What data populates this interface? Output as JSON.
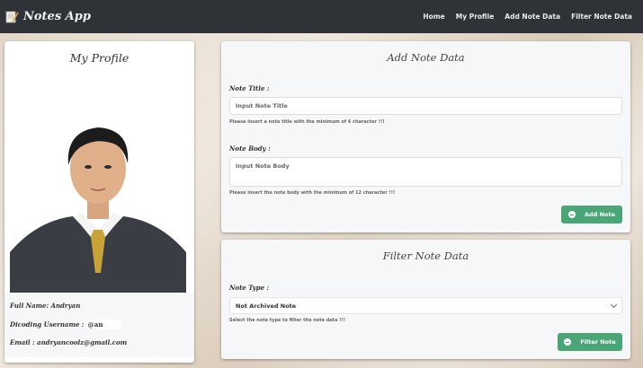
{
  "nav": {
    "brand": "Notes App",
    "links": [
      "Home",
      "My Profile",
      "Add Note Data",
      "Filter Note Data"
    ]
  },
  "profile": {
    "title": "My Profile",
    "full_name": "Full Name: Andryan",
    "username_label": "Dicoding Username :",
    "username_value": "@an",
    "email": "Email : andryancoolz@gmail.com"
  },
  "add_note": {
    "title": "Add Note Data",
    "title_label": "Note Title :",
    "title_placeholder": "Input Note Title",
    "title_help": "Please insert a note title with the minimum of 6 character !!!",
    "body_label": "Note Body :",
    "body_placeholder": "Input Note Body",
    "body_help": "Please insert the note body with the minimum of 12 character !!!",
    "button": "Add Note"
  },
  "filter_note": {
    "title": "Filter Note Data",
    "type_label": "Note Type :",
    "selected": "Not Archived Note",
    "help": "Select the note type to filter the note data !!!",
    "button": "Filter Note"
  },
  "colors": {
    "navbar": "#2f3338",
    "button": "#4aa676"
  }
}
